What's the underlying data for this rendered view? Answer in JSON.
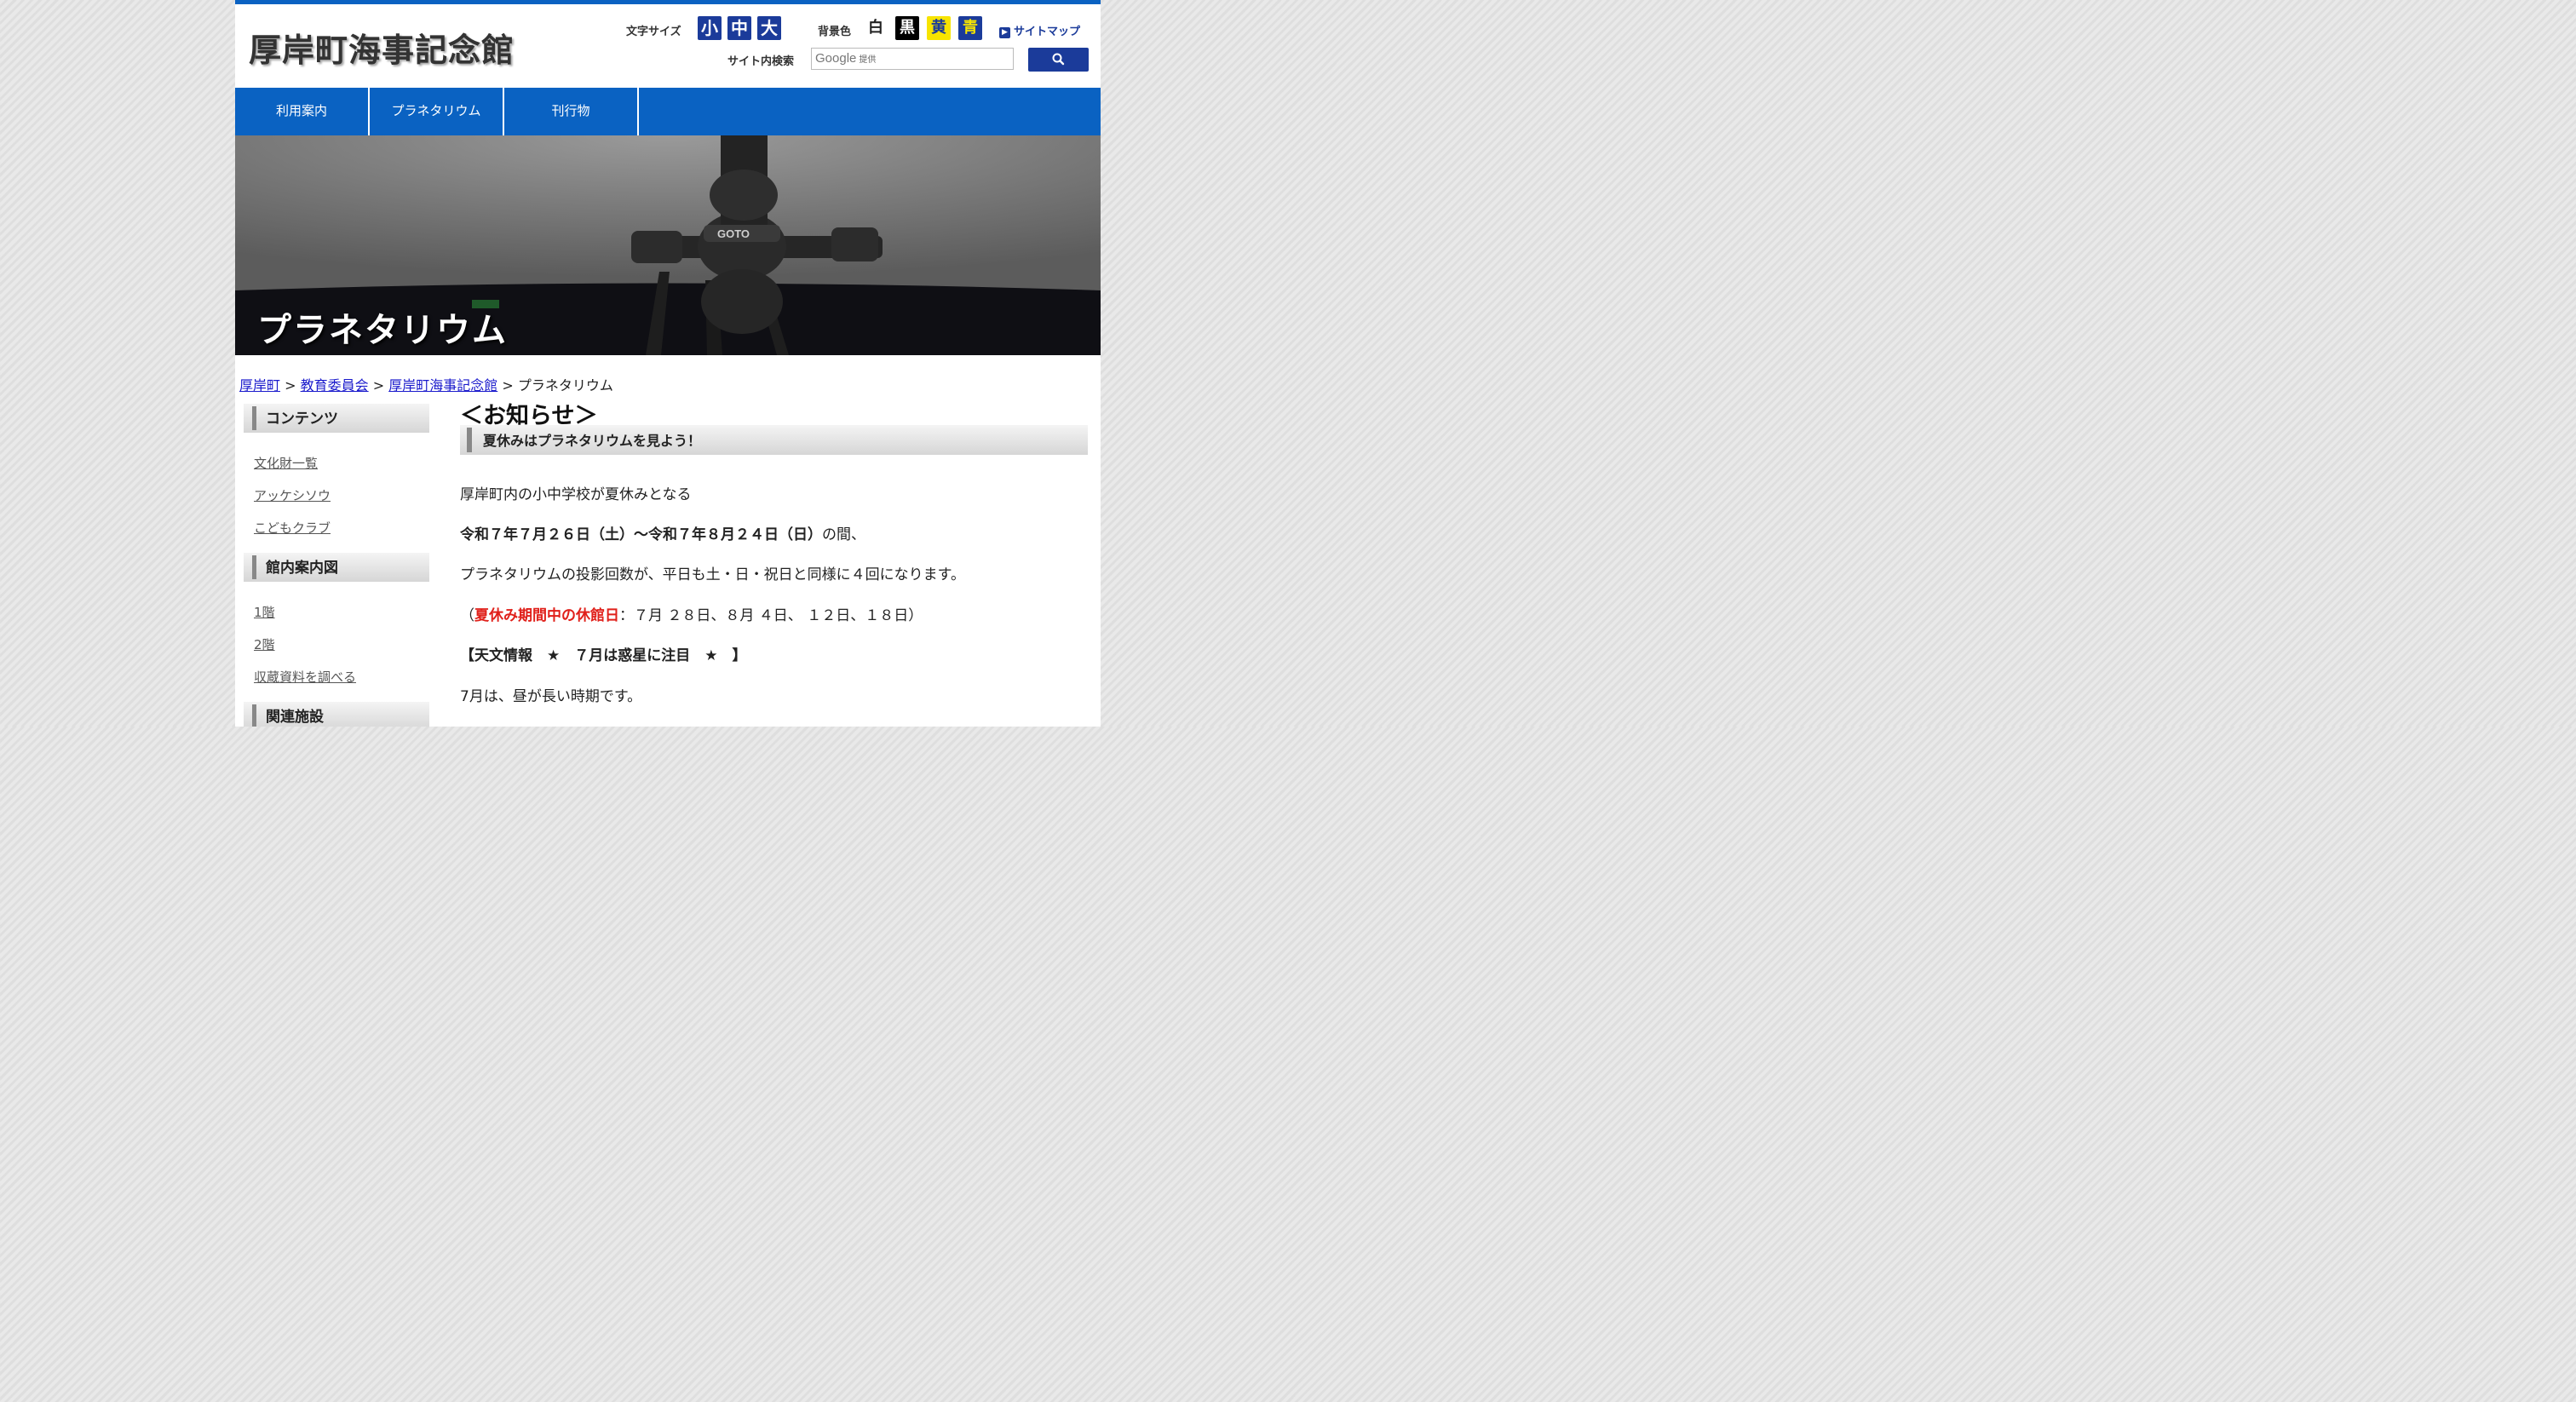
{
  "header": {
    "site_title": "厚岸町海事記念館",
    "font_size_label": "文字サイズ",
    "font_sizes": [
      "小",
      "中",
      "大"
    ],
    "bg_color_label": "背景色",
    "bg_colors": [
      {
        "label": "白",
        "bg": "#ffffff",
        "fg": "#222222"
      },
      {
        "label": "黒",
        "bg": "#000000",
        "fg": "#ffffff"
      },
      {
        "label": "黄",
        "bg": "#f7e400",
        "fg": "#1b3b9a"
      },
      {
        "label": "青",
        "bg": "#1b3b9a",
        "fg": "#f7e400"
      }
    ],
    "sitemap_label": "サイトマップ",
    "search_label": "サイト内検索",
    "search_brand": "Google",
    "search_provided": "提供"
  },
  "nav": {
    "items": [
      "利用案内",
      "プラネタリウム",
      "刊行物"
    ]
  },
  "hero": {
    "title": "プラネタリウム"
  },
  "breadcrumb": {
    "links": [
      "厚岸町",
      "教育委員会",
      "厚岸町海事記念館"
    ],
    "separator": ">",
    "current": "プラネタリウム"
  },
  "sidebar": {
    "sections": [
      {
        "heading": "コンテンツ",
        "links": [
          "文化財一覧",
          "アッケシソウ",
          "こどもクラブ"
        ]
      },
      {
        "heading": "館内案内図",
        "links": [
          "1階",
          "2階",
          "収蔵資料を調べる"
        ]
      },
      {
        "heading": "関連施設",
        "links": []
      }
    ]
  },
  "main": {
    "notice_title": "＜お知らせ＞",
    "section_heading": "夏休みはプラネタリウムを見よう！",
    "p1": "厚岸町内の小中学校が夏休みとなる",
    "p2_bold": "令和７年７月２６日（土）〜令和７年８月２４日（日）",
    "p2_rest": "の間、",
    "p3": "プラネタリウムの投影回数が、平日も土・日・祝日と同様に４回になります。",
    "p4_open": "（",
    "p4_red": "夏休み期間中の休館日",
    "p4_rest": "：７月 ２８日、８月 ４日、 １２日、１８日）",
    "p5": "【天文情報　★　７月は惑星に注目　★　】",
    "p6": "7月は、昼が長い時期です。"
  }
}
